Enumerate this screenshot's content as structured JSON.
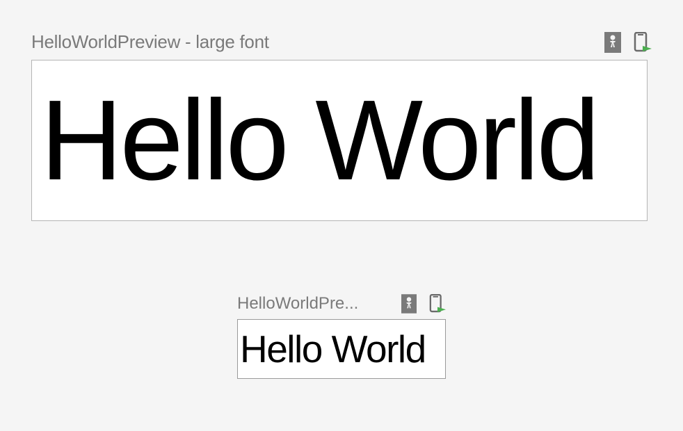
{
  "previews": {
    "large": {
      "title": "HelloWorldPreview - large font",
      "content": "Hello World"
    },
    "normal": {
      "title": "HelloWorldPre...",
      "content": "Hello World"
    }
  },
  "icons": {
    "interactive": "interactive-preview-icon",
    "deploy": "deploy-to-device-icon"
  }
}
